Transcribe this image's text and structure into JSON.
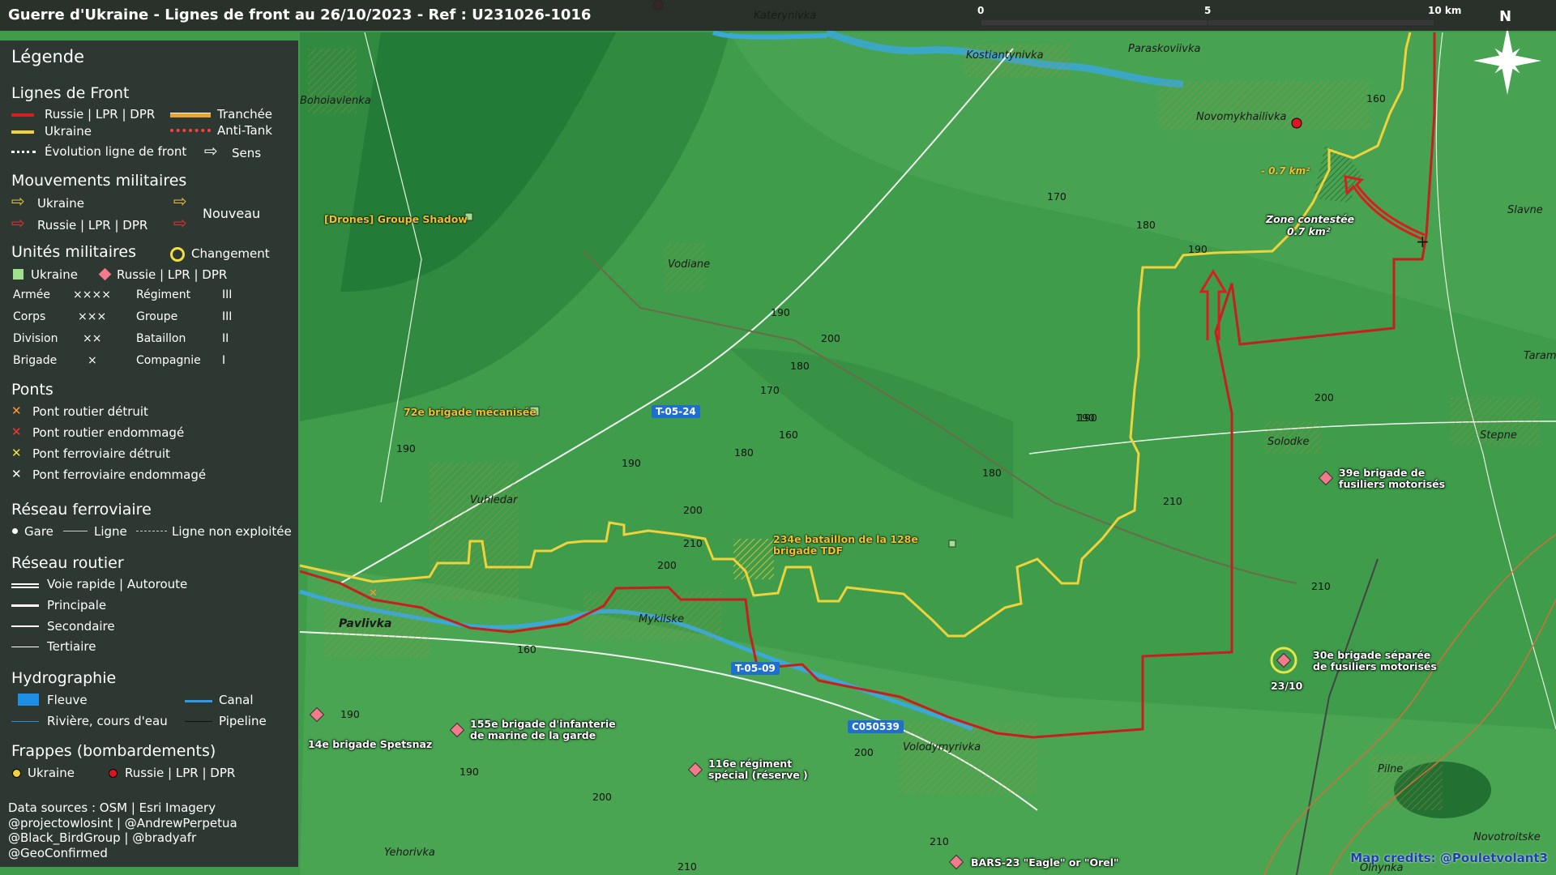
{
  "title": "Guerre d'Ukraine - Lignes de front au 26/10/2023 - Ref : U231026-1016",
  "scale": {
    "t0": "0",
    "t5": "5",
    "t10": "10 km"
  },
  "north": "N",
  "colors": {
    "russia": "#d81f1f",
    "ukraine": "#f0d23a",
    "trench": "#e8a530",
    "panel": "#2d3030",
    "map_green": "#3d9a4a"
  },
  "legend": {
    "title": "Légende",
    "front": {
      "heading": "Lignes de Front",
      "russia": "Russie | LPR | DPR",
      "ukraine": "Ukraine",
      "trench": "Tranchée",
      "antitank": "Anti-Tank",
      "evolution": "Évolution ligne de front",
      "direction": "Sens"
    },
    "moves": {
      "heading": "Mouvements militaires",
      "ukraine": "Ukraine",
      "russia": "Russie | LPR | DPR",
      "new": "Nouveau"
    },
    "units": {
      "heading": "Unités militaires",
      "change": "Changement",
      "ukraine": "Ukraine",
      "russia": "Russie | LPR | DPR",
      "rows": [
        {
          "a": "Armée",
          "as": "××××",
          "b": "Régiment",
          "bs": "III"
        },
        {
          "a": "Corps",
          "as": "×××",
          "b": "Groupe",
          "bs": "III"
        },
        {
          "a": "Division",
          "as": "××",
          "b": "Bataillon",
          "bs": "II"
        },
        {
          "a": "Brigade",
          "as": "×",
          "b": "Compagnie",
          "bs": "I"
        }
      ]
    },
    "bridges": {
      "heading": "Ponts",
      "road_destroyed": "Pont routier détruit",
      "road_damaged": "Pont routier endommagé",
      "rail_destroyed": "Pont ferroviaire détruit",
      "rail_damaged": "Pont ferroviaire endommagé"
    },
    "rail": {
      "heading": "Réseau ferroviaire",
      "station": "Gare",
      "line": "Ligne",
      "unused": "Ligne non exploitée"
    },
    "roads": {
      "heading": "Réseau routier",
      "highway": "Voie rapide | Autoroute",
      "main": "Principale",
      "secondary": "Secondaire",
      "tertiary": "Tertiaire"
    },
    "hydro": {
      "heading": "Hydrographie",
      "river": "Fleuve",
      "canal": "Canal",
      "stream": "Rivière, cours d'eau",
      "pipeline": "Pipeline"
    },
    "strikes": {
      "heading": "Frappes (bombardements)",
      "ukraine": "Ukraine",
      "russia": "Russie | LPR | DPR"
    },
    "sources": [
      "Data sources : OSM | Esri Imagery",
      "@projectowlosint | @AndrewPerpetua",
      "@Black_BirdGroup | @bradyafr",
      "@GeoConfirmed"
    ]
  },
  "places": {
    "katerynivka": "Katerynivka",
    "kostiantynivka": "Kostiantynivka",
    "paraskoviivka": "Paraskoviivka",
    "novomykhailivka": "Novomykhailivka",
    "bohoiavlenka": "Bohoiavlenka",
    "vodiane": "Vodiane",
    "vuhledar": "Vuhledar",
    "pavlivka": "Pavlivka",
    "mykilske": "Mykilske",
    "volodymyrivka": "Volodymyrivka",
    "yehorivka": "Yehorivka",
    "solodke": "Solodke",
    "stepne": "Stepne",
    "slavne": "Slavne",
    "taram": "Taram",
    "pilne": "Pilne",
    "novotroitske": "Novotroitske",
    "olhynka": "Olhynka"
  },
  "units_on_map": {
    "drones_shadow": "[Drones] Groupe Shadow",
    "brig72": "72e brigade mécanisée",
    "bat234": "234e bataillon de la 128e brigade TDF",
    "brig39": "39e brigade de fusiliers motorisés",
    "brig30": "30e brigade séparée de fusiliers motorisés",
    "brig30_date": "23/10",
    "spetsnaz14": "14e brigade Spetsnaz",
    "brig155": "155e brigade d'infanterie de marine de la garde",
    "reg116": "116e régiment spécial (réserve )",
    "bars23": "BARS-23 \"Eagle\" or \"Orel\""
  },
  "zone": {
    "area": "- 0.7 km²",
    "contested": "Zone contestée",
    "contested_area": "0.7 km²"
  },
  "roads_on_map": {
    "t0524": "T-05-24",
    "t0509": "T-05-09",
    "c050539": "C050539"
  },
  "elevations": [
    "160",
    "170",
    "180",
    "190",
    "190",
    "190",
    "200",
    "170",
    "180",
    "160",
    "190",
    "180",
    "190",
    "200",
    "210",
    "200",
    "180",
    "210",
    "200",
    "190",
    "210",
    "160",
    "190",
    "190",
    "200",
    "200",
    "210",
    "210"
  ],
  "map_credit": "Map credits: @Pouletvolant3"
}
